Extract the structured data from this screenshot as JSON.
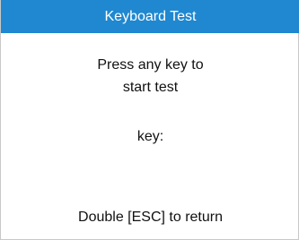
{
  "window": {
    "title": "Keyboard Test"
  },
  "main": {
    "prompt_line_1": "Press any key to",
    "prompt_line_2": "start test",
    "key_label": "key:",
    "footer": "Double [ESC] to return"
  },
  "colors": {
    "title_bar_bg": "#1f88d0",
    "title_text": "#ffffff",
    "body_bg": "#ffffff",
    "body_text": "#111111"
  }
}
